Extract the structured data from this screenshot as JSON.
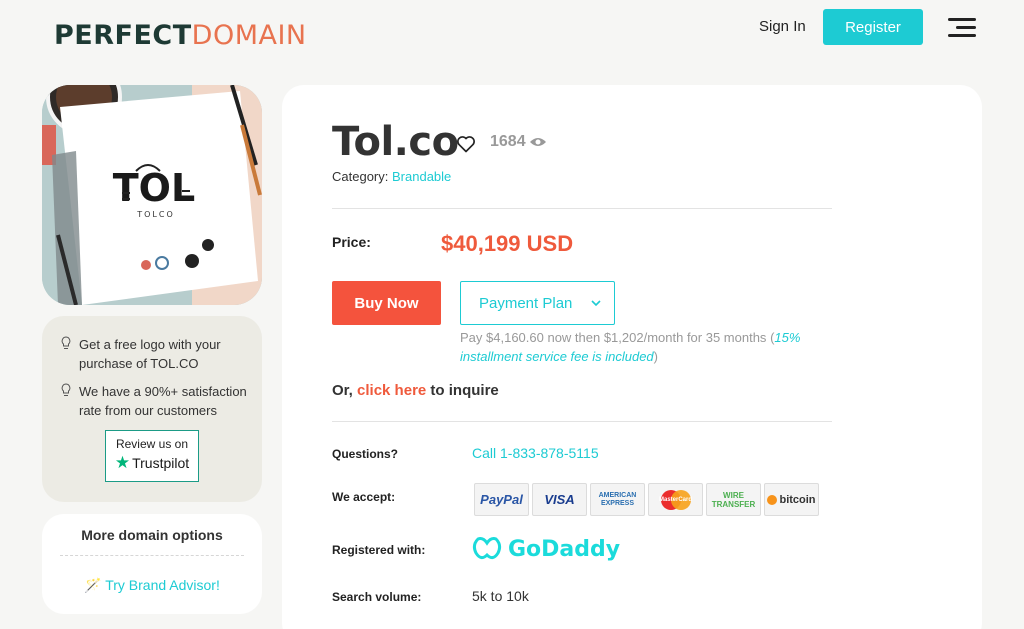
{
  "header": {
    "logo_part1": "PERFECT",
    "logo_part2": "DOMAIN",
    "signin_label": "Sign In",
    "register_label": "Register"
  },
  "hero": {
    "logo_text": "TOL",
    "logo_sub": "TOLCO"
  },
  "tips": {
    "items": [
      "Get a free logo with your purchase of TOL.CO",
      "We have a 90%+ satisfaction rate from our customers"
    ],
    "review_line1": "Review us on",
    "review_line2": "Trustpilot"
  },
  "more_options": {
    "title": "More domain options",
    "advisor_label": "Try Brand Advisor!"
  },
  "domain": {
    "name": "Tol.co",
    "views": "1684",
    "category_label": "Category:",
    "category_value": "Brandable"
  },
  "pricing": {
    "price_label": "Price:",
    "price": "$40,199 USD",
    "buy_label": "Buy Now",
    "plan_label": "Payment Plan",
    "plan_terms": "Pay $4,160.60 now then $1,202/month for 35 months",
    "plan_paren_open": "(",
    "plan_fee": "15% installment service fee is included",
    "plan_paren_close": ")",
    "inquire_prefix": "Or,",
    "inquire_link": "click here",
    "inquire_suffix": "to inquire"
  },
  "details": {
    "questions_label": "Questions?",
    "questions_value": "Call 1-833-878-5115",
    "accept_label": "We accept:",
    "payment_methods": [
      "PayPal",
      "VISA",
      "AMERICAN EXPRESS",
      "MasterCard",
      "WIRE TRANSFER",
      "bitcoin"
    ],
    "registered_label": "Registered with:",
    "registrar": "GoDaddy",
    "search_label": "Search volume:",
    "search_value": "5k to 10k"
  },
  "colors": {
    "accent": "#1dcbd3",
    "price": "#ef5a3c",
    "buy": "#f4533d",
    "logo_dark": "#1e3a34",
    "logo_orange": "#e8734f"
  }
}
